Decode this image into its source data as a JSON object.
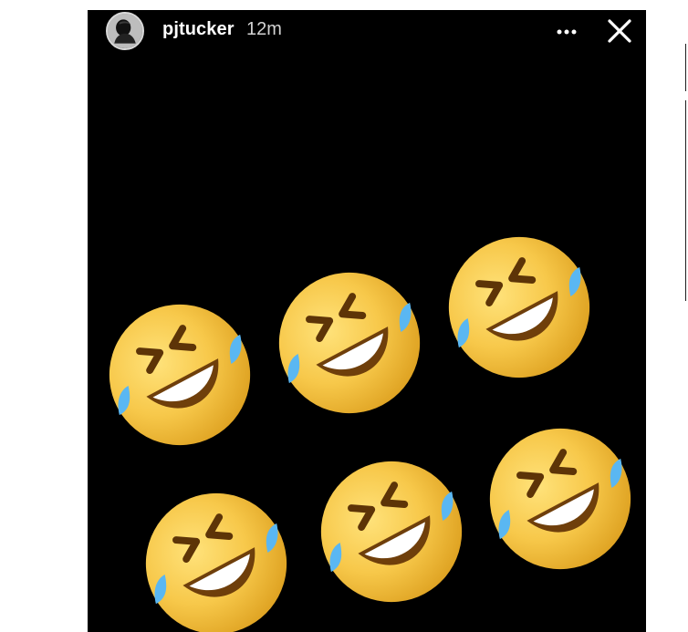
{
  "story": {
    "username": "pjtucker",
    "timestamp": "12m",
    "more_icon": "more-horizontal-icon",
    "close_icon": "close-icon",
    "emoji_count": 6,
    "emoji_name": "rolling-on-the-floor-laughing-emoji",
    "background_color": "#000000",
    "accent_color": "#f6c343",
    "tear_color": "#5ab7f2"
  }
}
